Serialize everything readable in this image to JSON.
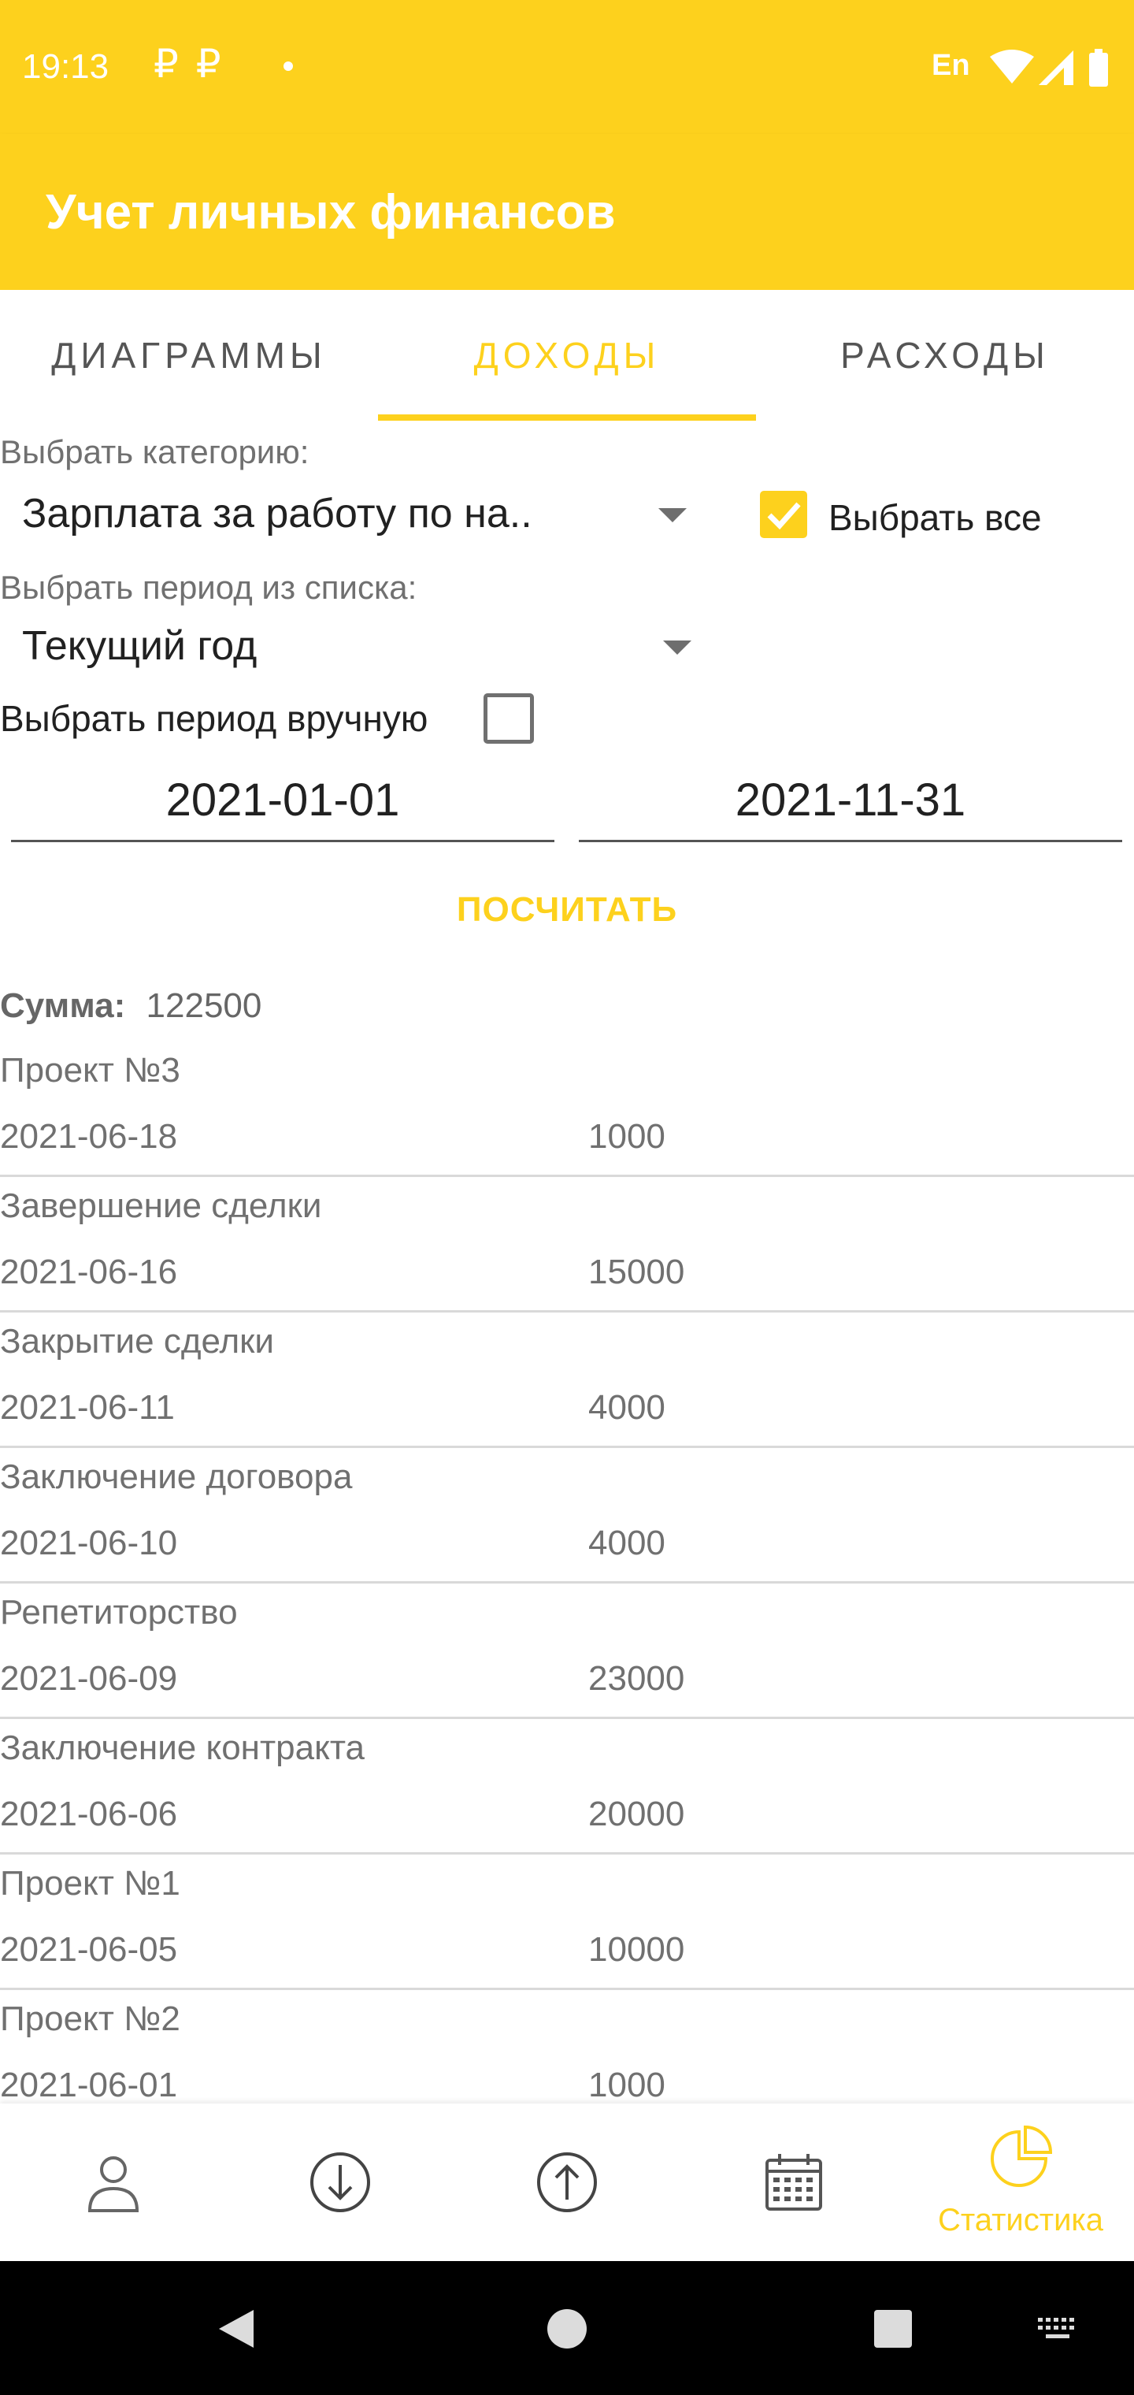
{
  "status_bar": {
    "time": "19:13",
    "notification_icons": "₽₽",
    "language": "En",
    "icons": [
      "wifi-icon",
      "cell-signal-icon",
      "battery-icon"
    ]
  },
  "app_bar": {
    "title": "Учет личных финансов"
  },
  "tabs": [
    {
      "label": "Диаграммы",
      "active": false
    },
    {
      "label": "Доходы",
      "active": true
    },
    {
      "label": "Расходы",
      "active": false
    }
  ],
  "filters": {
    "category_label": "Выбрать категорию:",
    "category_value": "Зарплата за работу по на..",
    "select_all_label": "Выбрать все",
    "select_all_checked": true,
    "period_label": "Выбрать период из списка:",
    "period_value": "Текущий год",
    "manual_period_label": "Выбрать период вручную",
    "manual_period_checked": false,
    "date_from": "2021-01-01",
    "date_to": "2021-11-31",
    "calculate_label": "ПОСЧИТАТЬ"
  },
  "summary": {
    "label": "Сумма:",
    "value": "122500"
  },
  "items": [
    {
      "title": "Проект №3",
      "date": "2021-06-18",
      "amount": "1000"
    },
    {
      "title": "Завершение сделки",
      "date": "2021-06-16",
      "amount": "15000"
    },
    {
      "title": "Закрытие сделки",
      "date": "2021-06-11",
      "amount": "4000"
    },
    {
      "title": "Заключение договора",
      "date": "2021-06-10",
      "amount": "4000"
    },
    {
      "title": "Репетиторство",
      "date": "2021-06-09",
      "amount": "23000"
    },
    {
      "title": "Заключение контракта",
      "date": "2021-06-06",
      "amount": "20000"
    },
    {
      "title": "Проект №1",
      "date": "2021-06-05",
      "amount": "10000"
    },
    {
      "title": "Проект №2",
      "date": "2021-06-01",
      "amount": "1000"
    }
  ],
  "bottom_nav": [
    {
      "icon": "person-icon",
      "label": ""
    },
    {
      "icon": "arrow-down-circle-icon",
      "label": ""
    },
    {
      "icon": "arrow-up-circle-icon",
      "label": ""
    },
    {
      "icon": "calendar-icon",
      "label": ""
    },
    {
      "icon": "pie-chart-icon",
      "label": "Статистика",
      "active": true
    }
  ],
  "system_nav": [
    "back-icon",
    "home-icon",
    "recents-icon",
    "keyboard-icon"
  ],
  "colors": {
    "accent": "#FDD11D",
    "text_secondary": "#707070",
    "divider": "#d9d9d9"
  }
}
